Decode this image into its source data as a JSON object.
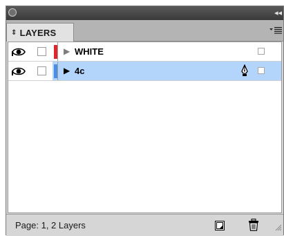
{
  "panel": {
    "tab_label": "LAYERS",
    "tab_icon": "up-down-arrows-icon",
    "menu_icon": "panel-menu-icon",
    "collapse_icon": "collapse-arrows-icon"
  },
  "layers": [
    {
      "name": "WHITE",
      "visible": true,
      "locked": false,
      "color": "#e0262a",
      "expander": "collapsed",
      "selected": false,
      "has_pen_icon": false
    },
    {
      "name": "4c",
      "visible": true,
      "locked": false,
      "color": "#4a8fe2",
      "expander": "collapsed",
      "selected": true,
      "has_pen_icon": true
    }
  ],
  "footer": {
    "status": "Page: 1, 2 Layers",
    "new_layer_icon": "new-layer-icon",
    "delete_icon": "trash-icon"
  },
  "colors": {
    "selection": "#b4d5fb",
    "titlebar": "#3a3a3a",
    "panel_bg": "#d6d6d6"
  }
}
